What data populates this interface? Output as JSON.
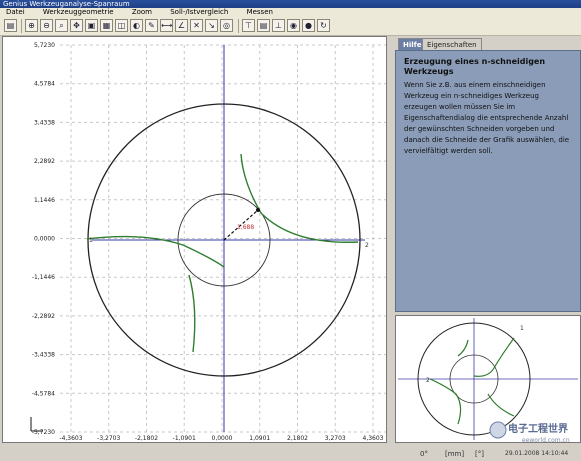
{
  "window": {
    "title": "Genius Werkzeuganalyse-Spanraum"
  },
  "menu": [
    "Datei",
    "Werkzeuggeometrie",
    "Zoom",
    "Soll-/Istvergleich",
    "Messen"
  ],
  "plot": {
    "x_ticks": [
      "-4,3603",
      "-3,2703",
      "-2,1802",
      "-1,0901",
      "0,0000",
      "1,0901",
      "2,1802",
      "3,2703",
      "4,3603"
    ],
    "y_ticks": [
      "5,7230",
      "4,5784",
      "3,4338",
      "2,2892",
      "1,1446",
      "0,0000",
      "-1,1446",
      "-2,2892",
      "-3,4338",
      "-4,5784",
      "-5,7230"
    ],
    "radius_label": "1,688",
    "edge_label_left": "1",
    "edge_label_right": "2"
  },
  "tabs": {
    "help": "Hilfe",
    "properties": "Eigenschaften"
  },
  "help": {
    "title": "Erzeugung eines n-schneidigen Werkzeugs",
    "text": "Wenn Sie z.B. aus einem einschneidigen Werkzeug ein n-schneidiges Werkzeug erzeugen wollen müssen Sie im Eigenschaftendialog die entsprechende Anzahl der gewünschten Schneiden vorgeben und danach die Schneide der Grafik auswählen, die vervielfältigt werden soll."
  },
  "mini": {
    "label_1": "1",
    "label_2": "2"
  },
  "status": {
    "angle": "0°",
    "unit": "[mm]",
    "deg": "[°]",
    "datetime": "29.01.2008  14:10:44"
  },
  "watermark": {
    "text_cn": "电子工程世界",
    "site": "eeworld.com.cn"
  },
  "colors": {
    "curve": "#2f7d2f",
    "circle": "#222222",
    "axis": "#3a3aa8",
    "grid": "#c8c8c8",
    "help_bg": "#8a9cb8"
  }
}
